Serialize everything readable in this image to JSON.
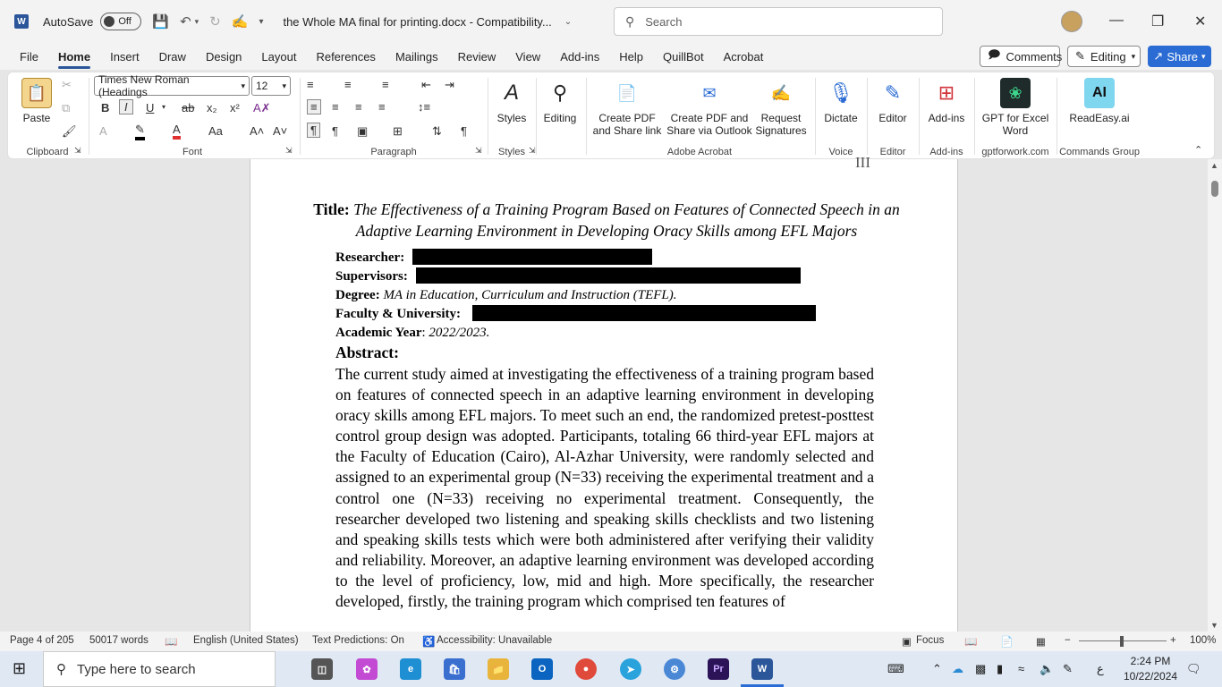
{
  "titlebar": {
    "app_icon": "W",
    "autosave_label": "AutoSave",
    "autosave_state": "Off",
    "doc_title": "the Whole MA final for printing.docx  -  Compatibility...",
    "search_placeholder": "Search",
    "minimize": "—",
    "maximize": "❐",
    "close": "✕"
  },
  "menu": {
    "tabs": [
      "File",
      "Home",
      "Insert",
      "Draw",
      "Design",
      "Layout",
      "References",
      "Mailings",
      "Review",
      "View",
      "Add-ins",
      "Help",
      "QuillBot",
      "Acrobat"
    ],
    "active": "Home",
    "comments": "Comments",
    "editing": "Editing",
    "share": "Share"
  },
  "ribbon": {
    "clipboard": {
      "paste": "Paste",
      "label": "Clipboard"
    },
    "font": {
      "name": "Times New Roman (Headings",
      "size": "12",
      "label": "Font"
    },
    "paragraph": {
      "label": "Paragraph"
    },
    "styles": {
      "button": "Styles",
      "label": "Styles"
    },
    "editing": {
      "button": "Editing"
    },
    "acrobat": {
      "btn1": "Create PDF and Share link",
      "btn2": "Create PDF and Share via Outlook",
      "btn3": "Request Signatures",
      "label": "Adobe Acrobat"
    },
    "voice": {
      "button": "Dictate",
      "label": "Voice"
    },
    "editor": {
      "button": "Editor",
      "label": "Editor"
    },
    "addins": {
      "button": "Add-ins",
      "label": "Add-ins"
    },
    "gpt": {
      "button": "GPT for Excel Word",
      "label": "gptforwork.com"
    },
    "readeasy": {
      "button": "ReadEasy.ai",
      "label": "Commands Group"
    }
  },
  "document": {
    "page_number": "III",
    "title_label": "Title:",
    "title_text": "The Effectiveness of a Training Program Based on Features of Connected Speech in an Adaptive Learning Environment in Developing Oracy Skills among EFL Majors",
    "researcher_label": "Researcher:",
    "supervisors_label": "Supervisors:",
    "degree_label": "Degree:",
    "degree_value": "MA in Education, Curriculum and Instruction (TEFL).",
    "faculty_label": "Faculty & University:",
    "year_label": "Academic Year",
    "year_value": "2022/2023.",
    "abstract_heading": "Abstract:",
    "abstract_text": "The current study aimed at investigating the effectiveness of a training program based on features of connected speech in an adaptive learning environment in developing oracy skills among EFL majors. To meet such an end, the randomized pretest-posttest control group design was adopted. Participants, totaling 66 third-year EFL majors at the Faculty of Education (Cairo), Al-Azhar University, were randomly selected and assigned to an experimental group (N=33) receiving the experimental treatment and a control one (N=33) receiving no experimental treatment. Consequently, the researcher developed two listening and speaking skills checklists and two listening and speaking skills tests which were both administered after verifying their validity and reliability. Moreover, an adaptive learning environment was developed according to the level of proficiency, low, mid and high. More specifically, the researcher developed, firstly, the training program which comprised ten features of"
  },
  "status": {
    "page": "Page 4 of 205",
    "words": "50017 words",
    "language": "English (United States)",
    "predictions": "Text Predictions: On",
    "accessibility": "Accessibility: Unavailable",
    "focus": "Focus",
    "zoom": "100%"
  },
  "taskbar": {
    "search_placeholder": "Type here to search",
    "time": "2:24 PM",
    "date": "10/22/2024",
    "lang": "ع"
  }
}
